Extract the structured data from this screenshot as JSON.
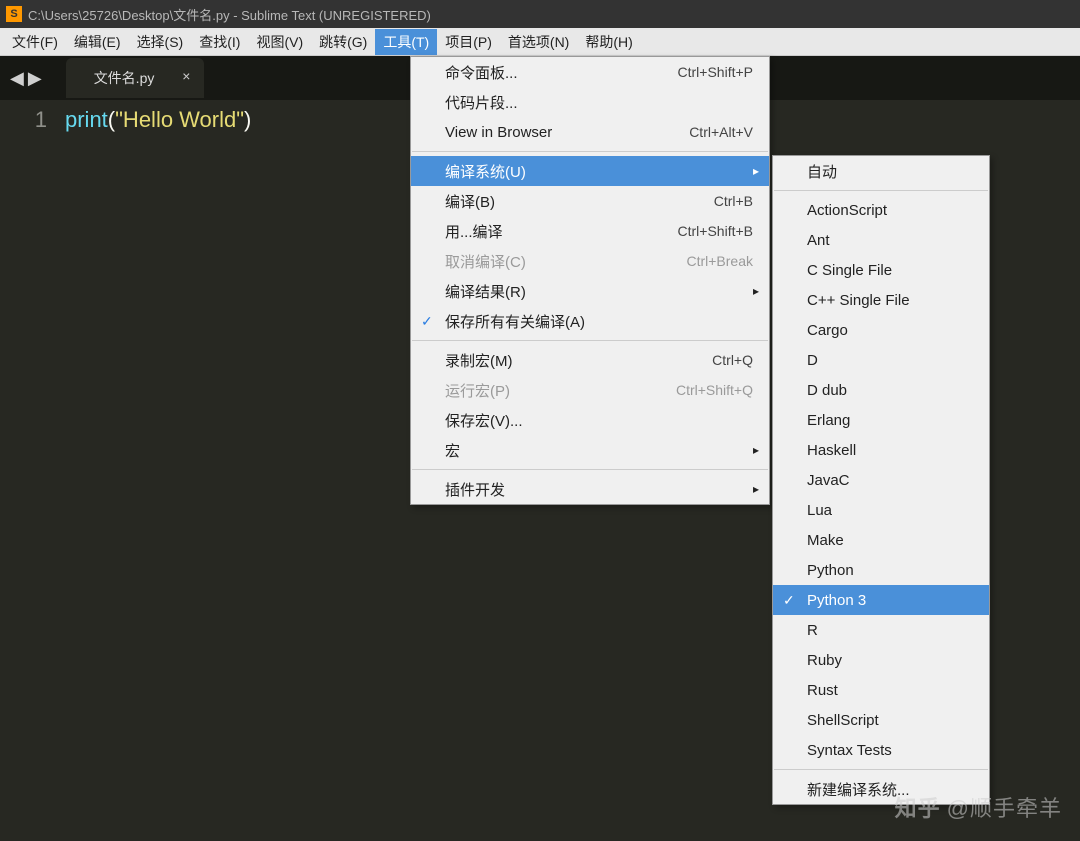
{
  "title": "C:\\Users\\25726\\Desktop\\文件名.py - Sublime Text (UNREGISTERED)",
  "menu_bar": {
    "file": "文件(F)",
    "edit": "编辑(E)",
    "select": "选择(S)",
    "find": "查找(I)",
    "view": "视图(V)",
    "goto": "跳转(G)",
    "tools": "工具(T)",
    "project": "项目(P)",
    "prefs": "首选项(N)",
    "help": "帮助(H)"
  },
  "tab": {
    "name": "文件名.py"
  },
  "editor": {
    "line1_no": "1",
    "func": "print",
    "open": "(",
    "string": "\"Hello World\"",
    "close": ")"
  },
  "tools_menu": [
    {
      "label": "命令面板...",
      "shortcut": "Ctrl+Shift+P"
    },
    {
      "label": "代码片段...",
      "shortcut": ""
    },
    {
      "label": "View in Browser",
      "shortcut": "Ctrl+Alt+V"
    },
    {
      "sep": true
    },
    {
      "label": "编译系统(U)",
      "shortcut": "",
      "submenu": true,
      "highlight": true
    },
    {
      "label": "编译(B)",
      "shortcut": "Ctrl+B"
    },
    {
      "label": "用...编译",
      "shortcut": "Ctrl+Shift+B"
    },
    {
      "label": "取消编译(C)",
      "shortcut": "Ctrl+Break",
      "disabled": true
    },
    {
      "label": "编译结果(R)",
      "shortcut": "",
      "submenu": true
    },
    {
      "label": "保存所有有关编译(A)",
      "shortcut": "",
      "checked": true
    },
    {
      "sep": true
    },
    {
      "label": "录制宏(M)",
      "shortcut": "Ctrl+Q"
    },
    {
      "label": "运行宏(P)",
      "shortcut": "Ctrl+Shift+Q",
      "disabled": true
    },
    {
      "label": "保存宏(V)...",
      "shortcut": ""
    },
    {
      "label": "宏",
      "shortcut": "",
      "submenu": true
    },
    {
      "sep": true
    },
    {
      "label": "插件开发",
      "shortcut": "",
      "submenu": true
    }
  ],
  "build_submenu": [
    {
      "label": "自动"
    },
    {
      "sep": true
    },
    {
      "label": "ActionScript"
    },
    {
      "label": "Ant"
    },
    {
      "label": "C Single File"
    },
    {
      "label": "C++ Single File"
    },
    {
      "label": "Cargo"
    },
    {
      "label": "D"
    },
    {
      "label": "D dub"
    },
    {
      "label": "Erlang"
    },
    {
      "label": "Haskell"
    },
    {
      "label": "JavaC"
    },
    {
      "label": "Lua"
    },
    {
      "label": "Make"
    },
    {
      "label": "Python"
    },
    {
      "label": "Python 3",
      "checked": true,
      "highlight": true
    },
    {
      "label": "R"
    },
    {
      "label": "Ruby"
    },
    {
      "label": "Rust"
    },
    {
      "label": "ShellScript"
    },
    {
      "label": "Syntax Tests"
    },
    {
      "sep": true
    },
    {
      "label": "新建编译系统..."
    }
  ],
  "watermark": {
    "logo": "知乎",
    "text": "@顺手牵羊"
  }
}
